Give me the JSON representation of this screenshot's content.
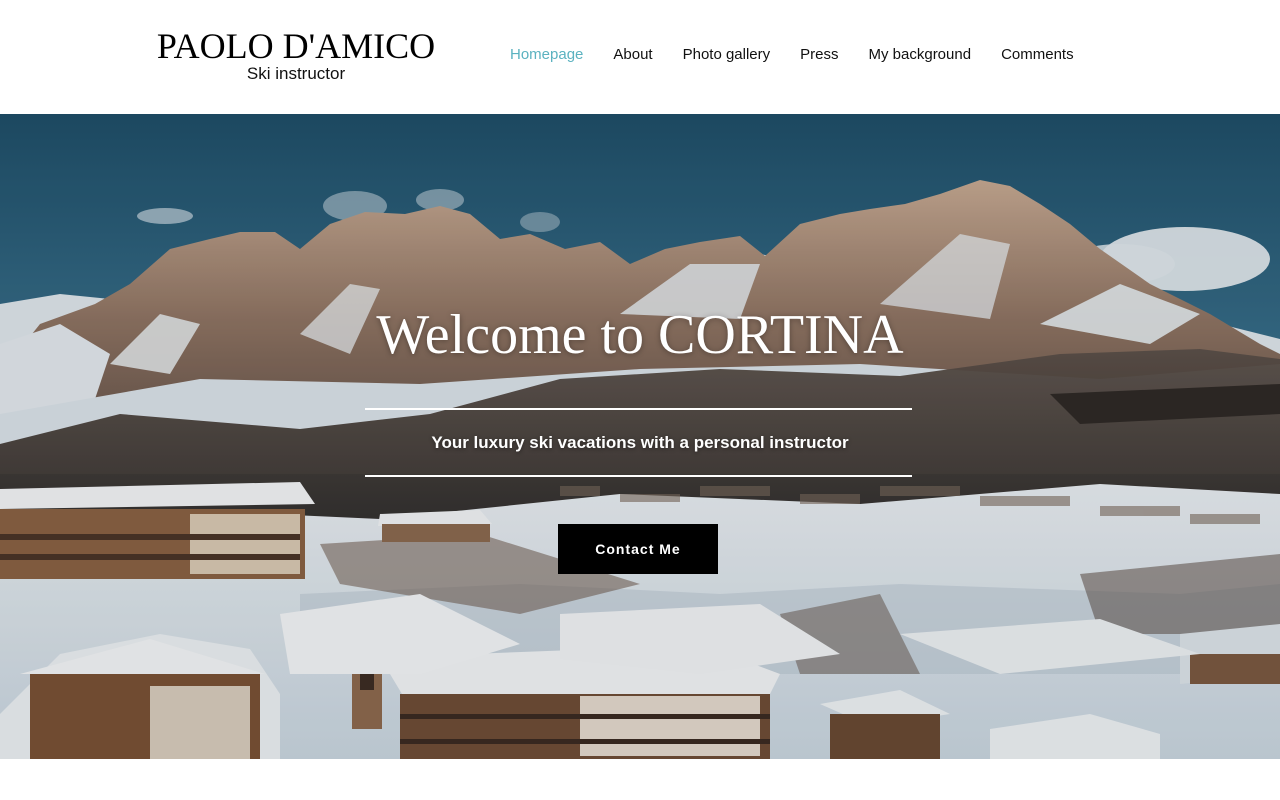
{
  "header": {
    "brand_name": "PAOLO D'AMICO",
    "brand_tagline": "Ski instructor",
    "nav": [
      {
        "label": "Homepage",
        "active": true
      },
      {
        "label": "About",
        "active": false
      },
      {
        "label": "Photo gallery",
        "active": false
      },
      {
        "label": "Press",
        "active": false
      },
      {
        "label": "My background",
        "active": false
      },
      {
        "label": "Comments",
        "active": false
      }
    ]
  },
  "hero": {
    "title": "Welcome to CORTINA",
    "subtitle": "Your luxury ski vacations with a personal instructor",
    "cta_label": "Contact Me",
    "background": "snowy-mountain-village-photo"
  },
  "colors": {
    "nav_active": "#5bb2c0",
    "nav_default": "#111111",
    "cta_background": "#000000",
    "cta_text": "#ffffff",
    "hero_text": "#ffffff"
  }
}
